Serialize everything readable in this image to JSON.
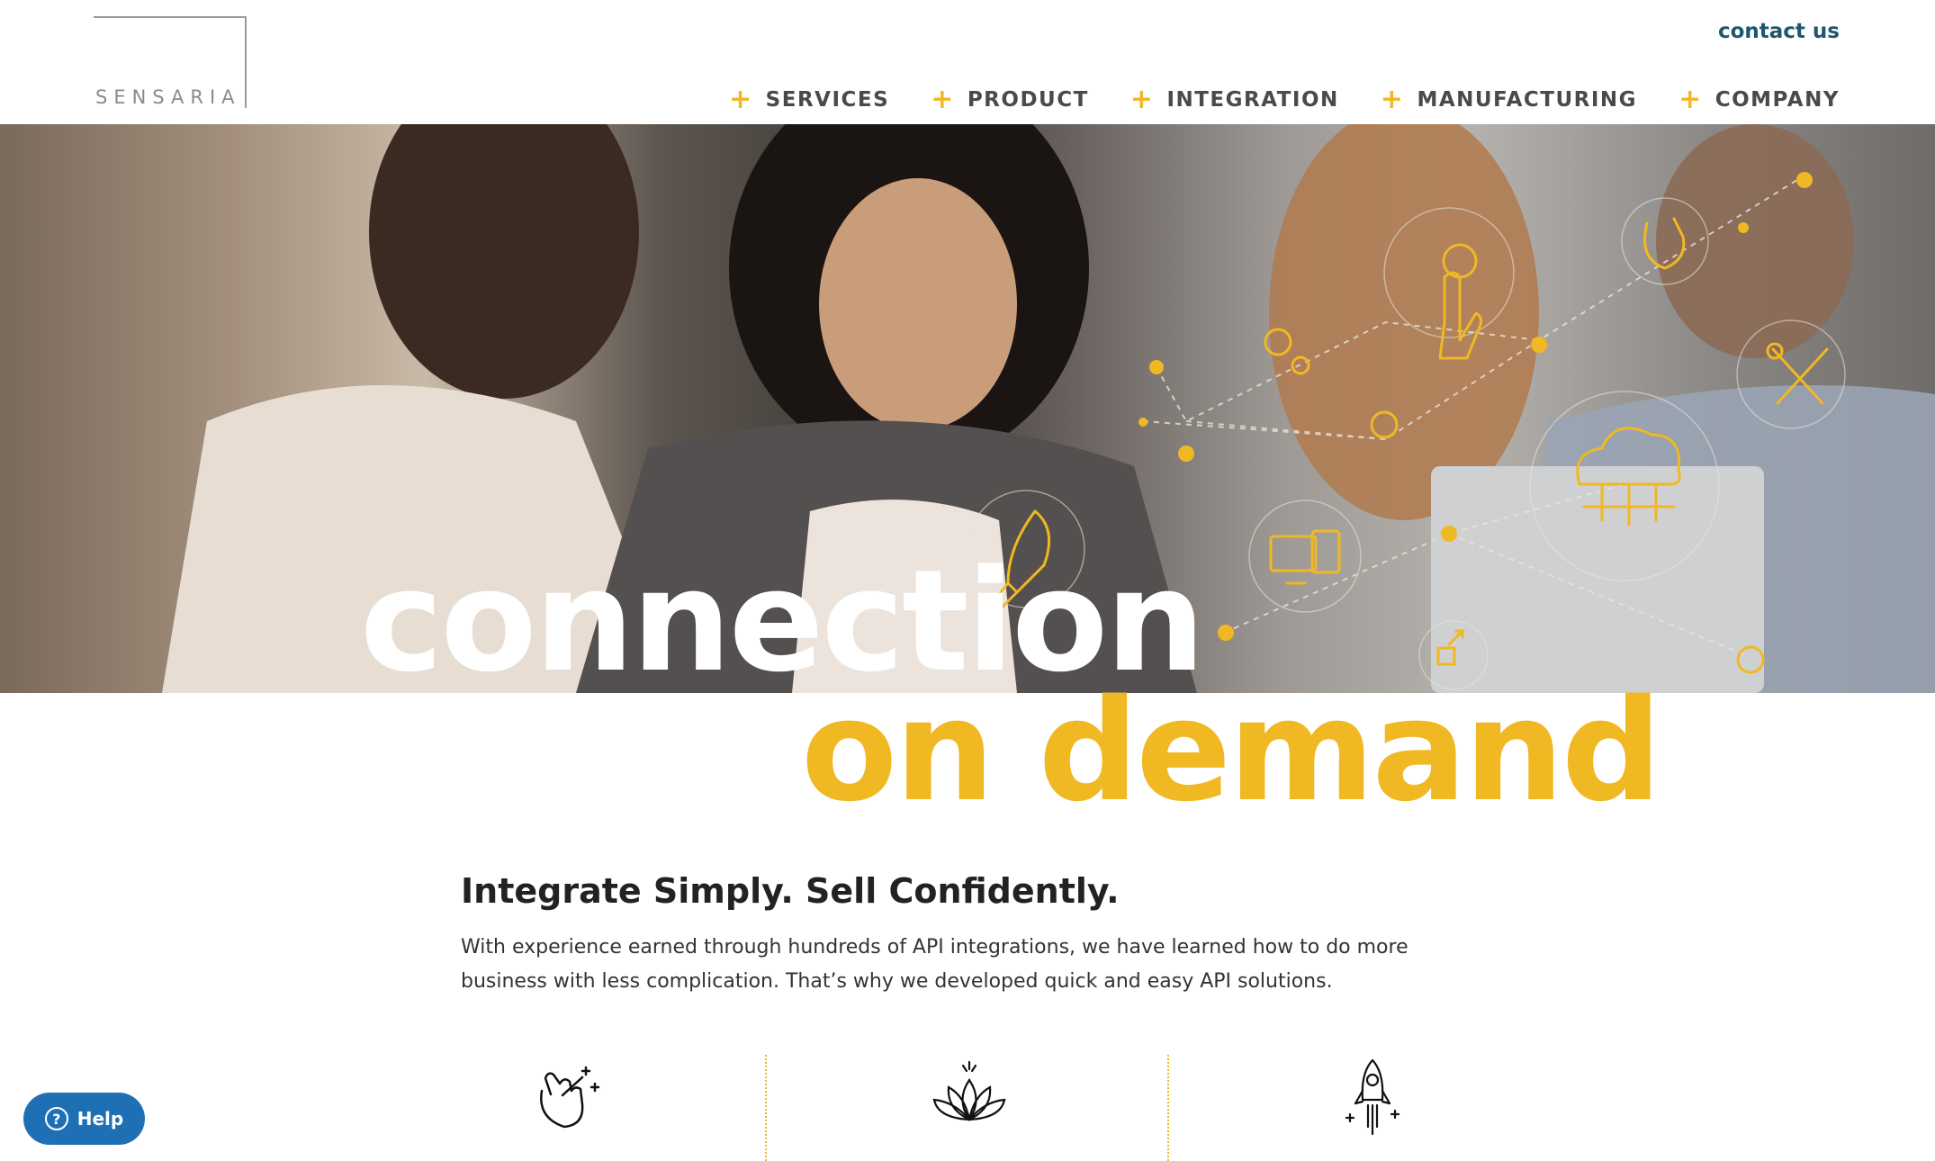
{
  "brand": {
    "logo_text": "SENSARIA",
    "accent": "#f0b822",
    "link_color": "#1e5570"
  },
  "header": {
    "contact_label": "contact us",
    "nav": [
      {
        "label": "SERVICES"
      },
      {
        "label": "PRODUCT"
      },
      {
        "label": "INTEGRATION"
      },
      {
        "label": "MANUFACTURING"
      },
      {
        "label": "COMPANY"
      }
    ]
  },
  "hero": {
    "line1": "connection",
    "line2": "on demand",
    "icons": [
      "rocket-icon",
      "gear-icon",
      "hand-touch-icon",
      "snap-fingers-icon",
      "tools-icon",
      "cloud-network-icon",
      "devices-icon",
      "expand-icon"
    ]
  },
  "content": {
    "headline": "Integrate Simply. Sell Confidently.",
    "body": "With experience earned through hundreds of API integrations, we have learned how to do more business with less complication. That’s why we developed quick and easy API solutions.",
    "features": [
      {
        "icon": "snap-fingers-icon"
      },
      {
        "icon": "lotus-icon"
      },
      {
        "icon": "rocket-icon"
      }
    ]
  },
  "help": {
    "label": "Help"
  }
}
